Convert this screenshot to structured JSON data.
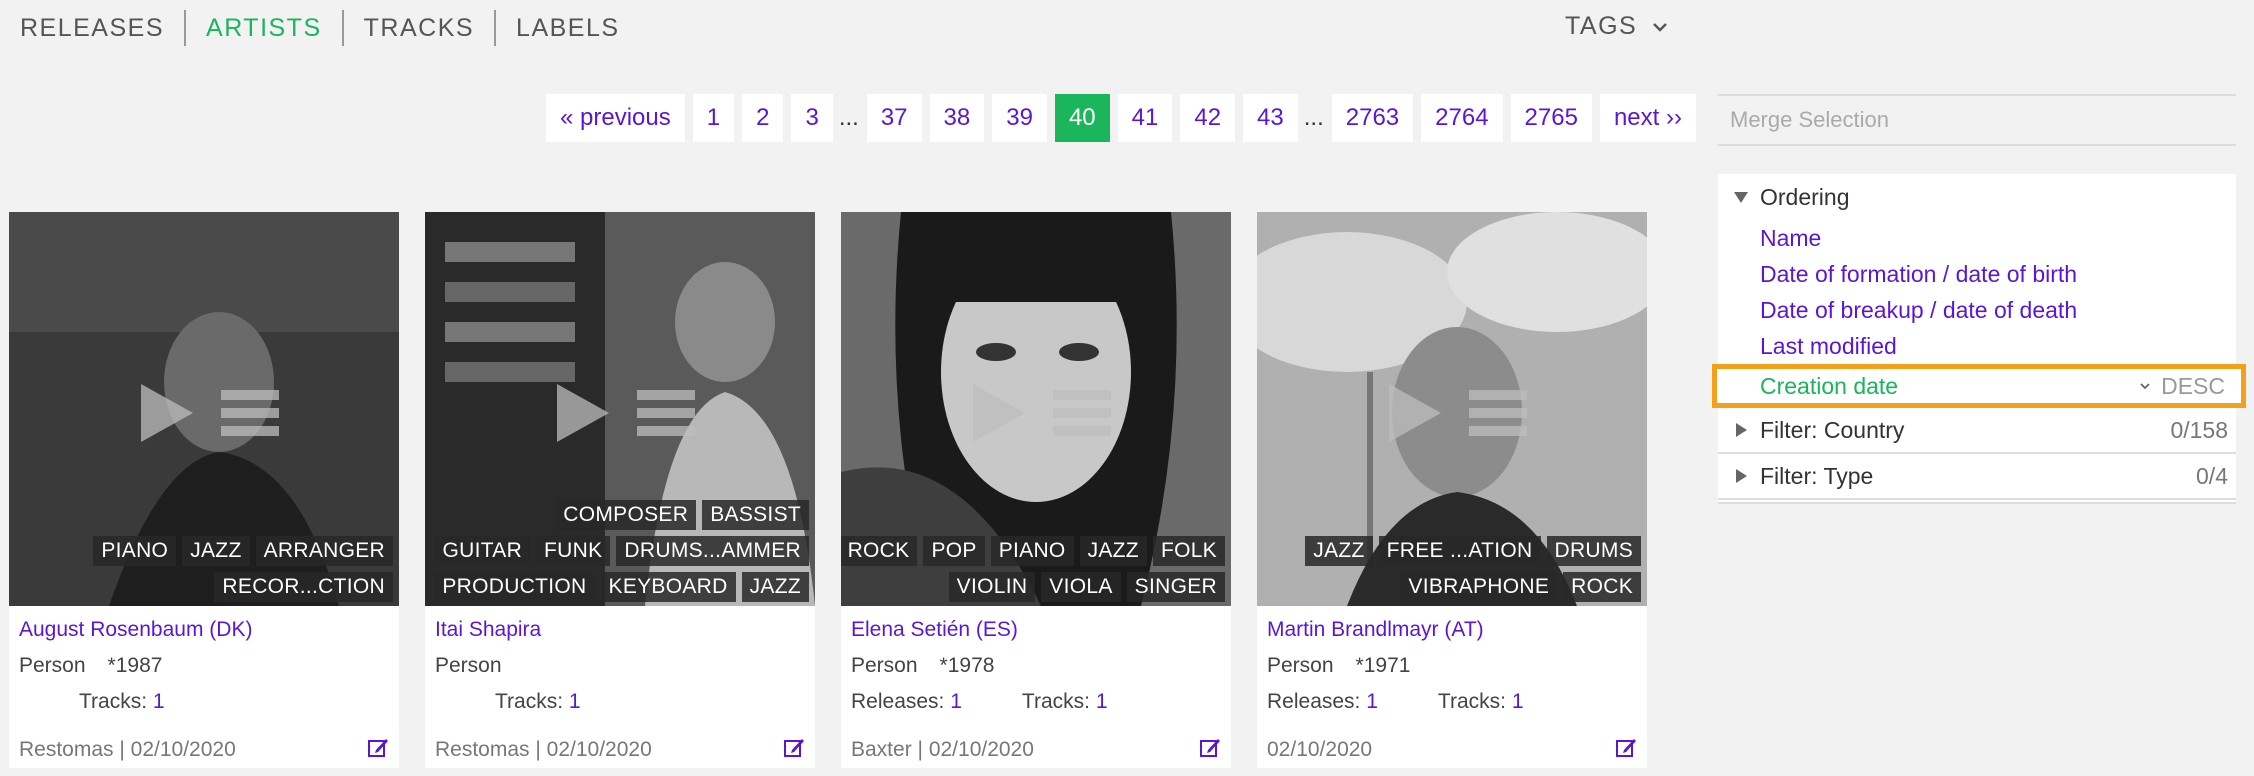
{
  "nav": {
    "items": [
      "RELEASES",
      "ARTISTS",
      "TRACKS",
      "LABELS"
    ],
    "active": "ARTISTS",
    "tags_label": "TAGS"
  },
  "pagination": {
    "previous": "« previous",
    "next": "next ››",
    "pages": [
      "1",
      "2",
      "3",
      "...",
      "37",
      "38",
      "39",
      "40",
      "41",
      "42",
      "43",
      "...",
      "2763",
      "2764",
      "2765"
    ],
    "current": "40"
  },
  "sidebar": {
    "merge_placeholder": "Merge Selection",
    "ordering_label": "Ordering",
    "order_items": [
      "Name",
      "Date of formation / date of birth",
      "Date of breakup / date of death",
      "Last modified"
    ],
    "selected_order": "Creation date",
    "selected_direction": "DESC",
    "filters": [
      {
        "label": "Filter: Country",
        "count": "0/158"
      },
      {
        "label": "Filter: Type",
        "count": "0/4"
      }
    ]
  },
  "cards": [
    {
      "name": "August Rosenbaum (DK)",
      "type": "Person",
      "year": "*1987",
      "releases_label": "",
      "releases": "",
      "tracks_label": "Tracks:",
      "tracks": "1",
      "footer": "Restomas | 02/10/2020",
      "tag_rows": [
        [
          "PIANO",
          "JAZZ",
          "ARRANGER"
        ],
        [
          "RECOR...CTION"
        ]
      ]
    },
    {
      "name": "Itai Shapira",
      "type": "Person",
      "year": "",
      "releases_label": "",
      "releases": "",
      "tracks_label": "Tracks:",
      "tracks": "1",
      "footer": "Restomas | 02/10/2020",
      "tag_rows": [
        [
          "COMPOSER",
          "BASSIST"
        ],
        [
          "GUITAR",
          "FUNK",
          "DRUMS...AMMER"
        ],
        [
          "PRODUCTION",
          "KEYBOARD",
          "JAZZ"
        ]
      ]
    },
    {
      "name": "Elena Setién (ES)",
      "type": "Person",
      "year": "*1978",
      "releases_label": "Releases:",
      "releases": "1",
      "tracks_label": "Tracks:",
      "tracks": "1",
      "footer": "Baxter | 02/10/2020",
      "tag_rows": [
        [
          "ROCK",
          "POP",
          "PIANO",
          "JAZZ",
          "FOLK"
        ],
        [
          "VIOLIN",
          "VIOLA",
          "SINGER"
        ]
      ]
    },
    {
      "name": "Martin Brandlmayr (AT)",
      "type": "Person",
      "year": "*1971",
      "releases_label": "Releases:",
      "releases": "1",
      "tracks_label": "Tracks:",
      "tracks": "1",
      "footer": "02/10/2020",
      "tag_rows": [
        [
          "JAZZ",
          "FREE ...ATION",
          "DRUMS"
        ],
        [
          "VIBRAPHONE",
          "ROCK"
        ]
      ]
    }
  ],
  "colors": {
    "accent_green": "#1bb55c",
    "link_purple": "#5a16d6",
    "highlight_orange": "#f5a01a"
  }
}
